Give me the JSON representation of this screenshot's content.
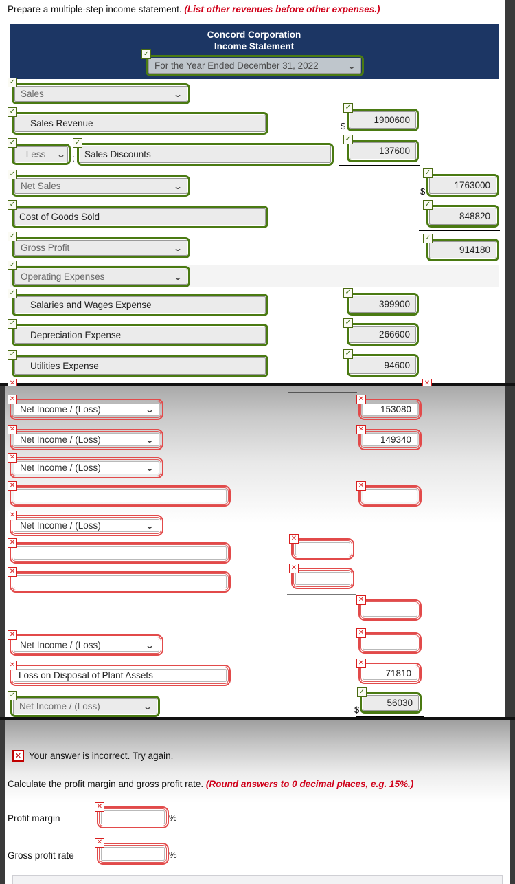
{
  "panel1": {
    "prompt": "Prepare a multiple-step income statement.",
    "prompt_hint": "(List other revenues before other expenses.)",
    "header": {
      "company": "Concord Corporation",
      "statement": "Income Statement",
      "period_select": "For the Year Ended December 31, 2022",
      "bg_color": "#1c3664"
    },
    "rows": [
      {
        "label": "Sales",
        "type": "select",
        "status": "ok"
      },
      {
        "label": "Sales Revenue",
        "type": "text",
        "status": "ok",
        "amount_col1": "1900600",
        "dollar1": "$"
      },
      {
        "label": "Sales Discounts",
        "type": "text",
        "status": "ok",
        "prefix_select": "Less",
        "colon": ":",
        "amount_col1": "137600"
      },
      {
        "label": "Net Sales",
        "type": "select",
        "status": "ok",
        "amount_col2": "1763000",
        "dollar2": "$"
      },
      {
        "label": "Cost of Goods Sold",
        "type": "text",
        "status": "ok",
        "amount_col2": "848820"
      },
      {
        "label": "Gross Profit",
        "type": "select",
        "status": "ok",
        "amount_col2": "914180"
      },
      {
        "label": "Operating Expenses",
        "type": "select",
        "status": "ok"
      },
      {
        "label": "Salaries and Wages Expense",
        "type": "text",
        "status": "ok",
        "amount_col1": "399900"
      },
      {
        "label": "Depreciation Expense",
        "type": "text",
        "status": "ok",
        "amount_col1": "266600"
      },
      {
        "label": "Utilities Expense",
        "type": "text",
        "status": "ok",
        "amount_col1": "94600"
      }
    ]
  },
  "panel2": {
    "rows": [
      {
        "label": "Net Income / (Loss)",
        "type": "select",
        "status": "bad",
        "amount_col1": "153080"
      },
      {
        "label": "Net Income / (Loss)",
        "type": "select",
        "status": "bad",
        "amount_col1": "149340"
      },
      {
        "label": "Net Income / (Loss)",
        "type": "select",
        "status": "bad",
        "amount_col1": ""
      },
      {
        "label": "",
        "type": "text",
        "status": "bad",
        "amount_col1": ""
      },
      {
        "label": "Net Income / (Loss)",
        "type": "select",
        "status": "bad"
      },
      {
        "label": "",
        "type": "text",
        "status": "bad",
        "amount_mid": ""
      },
      {
        "label": "",
        "type": "text",
        "status": "bad",
        "amount_mid": ""
      },
      {
        "label": "",
        "type": "none",
        "status": "bad",
        "amount_col1": ""
      },
      {
        "label": "Net Income / (Loss)",
        "type": "select",
        "status": "bad",
        "amount_col1": ""
      },
      {
        "label": "Loss on Disposal of Plant Assets",
        "type": "text",
        "status": "bad",
        "amount_col1": "71810"
      },
      {
        "label": "Net Income / (Loss)",
        "type": "select",
        "status": "ok",
        "amount_col1": "56030",
        "dollar1": "$"
      }
    ]
  },
  "panel3": {
    "error_icon": "x-icon",
    "error_message": "Your answer is incorrect.  Try again.",
    "instruction": "Calculate the profit margin and gross profit rate.",
    "instruction_hint": "(Round answers to 0 decimal places, e.g. 15%.)",
    "fields": [
      {
        "label": "Profit margin",
        "value": "",
        "suffix": "%",
        "status": "bad"
      },
      {
        "label": "Gross profit rate",
        "value": "",
        "suffix": "%",
        "status": "bad"
      }
    ]
  },
  "icons": {
    "check": "✓",
    "cross": "✕",
    "chevron_down": "⌄"
  },
  "colors": {
    "valid_border": "#4a7a12",
    "invalid_border": "#e24a4a",
    "header_navy": "#1c3664",
    "hint_red": "#d0021b"
  }
}
